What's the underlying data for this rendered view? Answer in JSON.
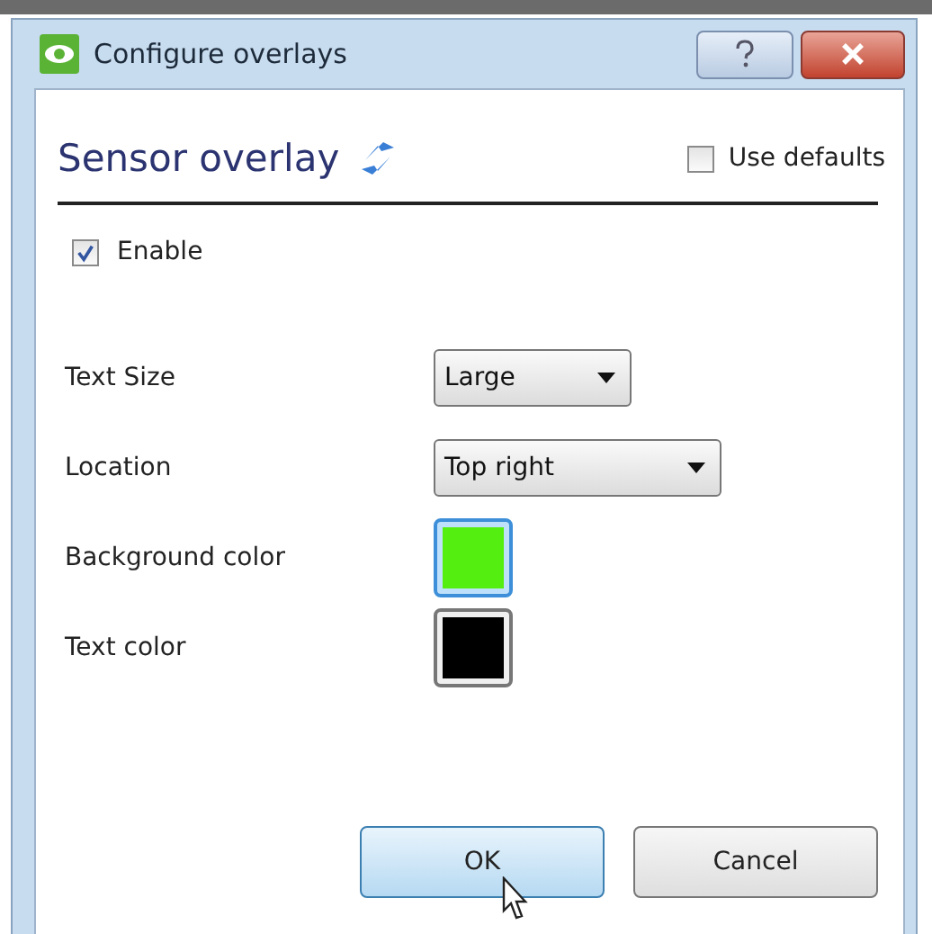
{
  "window": {
    "title": "Configure overlays"
  },
  "header": {
    "title": "Sensor overlay",
    "use_defaults": {
      "label": "Use defaults",
      "checked": false
    }
  },
  "enable": {
    "label": "Enable",
    "checked": true
  },
  "settings": [
    {
      "kind": "dropdown",
      "label": "Text Size",
      "value": "Large"
    },
    {
      "kind": "dropdown",
      "label": "Location",
      "value": "Top right"
    },
    {
      "kind": "color",
      "label": "Background color",
      "color": "#55ee11",
      "selected": true
    },
    {
      "kind": "color",
      "label": "Text color",
      "color": "#000000",
      "selected": false
    }
  ],
  "buttons": [
    {
      "label": "OK",
      "selected": true
    },
    {
      "label": "Cancel",
      "selected": false
    }
  ]
}
